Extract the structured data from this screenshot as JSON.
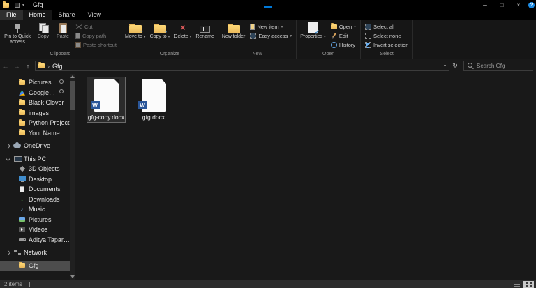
{
  "titlebar": {
    "title": "Gfg"
  },
  "tabs": {
    "file": "File",
    "home": "Home",
    "share": "Share",
    "view": "View"
  },
  "ribbon": {
    "clipboard": {
      "label": "Clipboard",
      "pin": "Pin to Quick access",
      "copy": "Copy",
      "paste": "Paste",
      "cut": "Cut",
      "copy_path": "Copy path",
      "paste_shortcut": "Paste shortcut"
    },
    "organize": {
      "label": "Organize",
      "move_to": "Move to",
      "copy_to": "Copy to",
      "delete": "Delete",
      "rename": "Rename"
    },
    "new": {
      "label": "New",
      "new_folder": "New folder",
      "new_item": "New item",
      "easy_access": "Easy access"
    },
    "open": {
      "label": "Open",
      "properties": "Properties",
      "open": "Open",
      "edit": "Edit",
      "history": "History"
    },
    "select": {
      "label": "Select",
      "select_all": "Select all",
      "select_none": "Select none",
      "invert_selection": "Invert selection"
    }
  },
  "address_bar": {
    "breadcrumb": "Gfg",
    "search_placeholder": "Search Gfg"
  },
  "sidebar": {
    "items": [
      {
        "label": "Pictures",
        "pinned": true
      },
      {
        "label": "Google Drive",
        "pinned": true
      },
      {
        "label": "Black Clover"
      },
      {
        "label": "images"
      },
      {
        "label": "Python Project"
      },
      {
        "label": "Your Name"
      },
      {
        "label": "OneDrive"
      },
      {
        "label": "This PC"
      },
      {
        "label": "3D Objects"
      },
      {
        "label": "Desktop"
      },
      {
        "label": "Documents"
      },
      {
        "label": "Downloads"
      },
      {
        "label": "Music"
      },
      {
        "label": "Pictures"
      },
      {
        "label": "Videos"
      },
      {
        "label": "Aditya Taparia (C:)"
      },
      {
        "label": "Network"
      },
      {
        "label": "Gfg",
        "selected": true
      }
    ]
  },
  "files": [
    {
      "name": "gfg-copy.docx",
      "selected": true
    },
    {
      "name": "gfg.docx",
      "selected": false
    }
  ],
  "status_bar": {
    "count": "2 items"
  },
  "icons": {
    "minimize": "─",
    "maximize": "□",
    "close": "×",
    "help": "?",
    "back": "←",
    "forward": "→",
    "up": "↑",
    "refresh": "↻",
    "breadcrumb_chevron": "›",
    "dropdown": "▾",
    "delete_x": "×",
    "properties_check": "✓",
    "music_note": "♪",
    "download_arrow": "↓",
    "word_badge": "W",
    "move_arrow": "→"
  },
  "colors": {
    "accent_blue": "#0078d7",
    "word_blue": "#2b579a",
    "folder_yellow": "#f0c04a",
    "selection_gray": "#4d4d4d",
    "background": "#191919"
  }
}
